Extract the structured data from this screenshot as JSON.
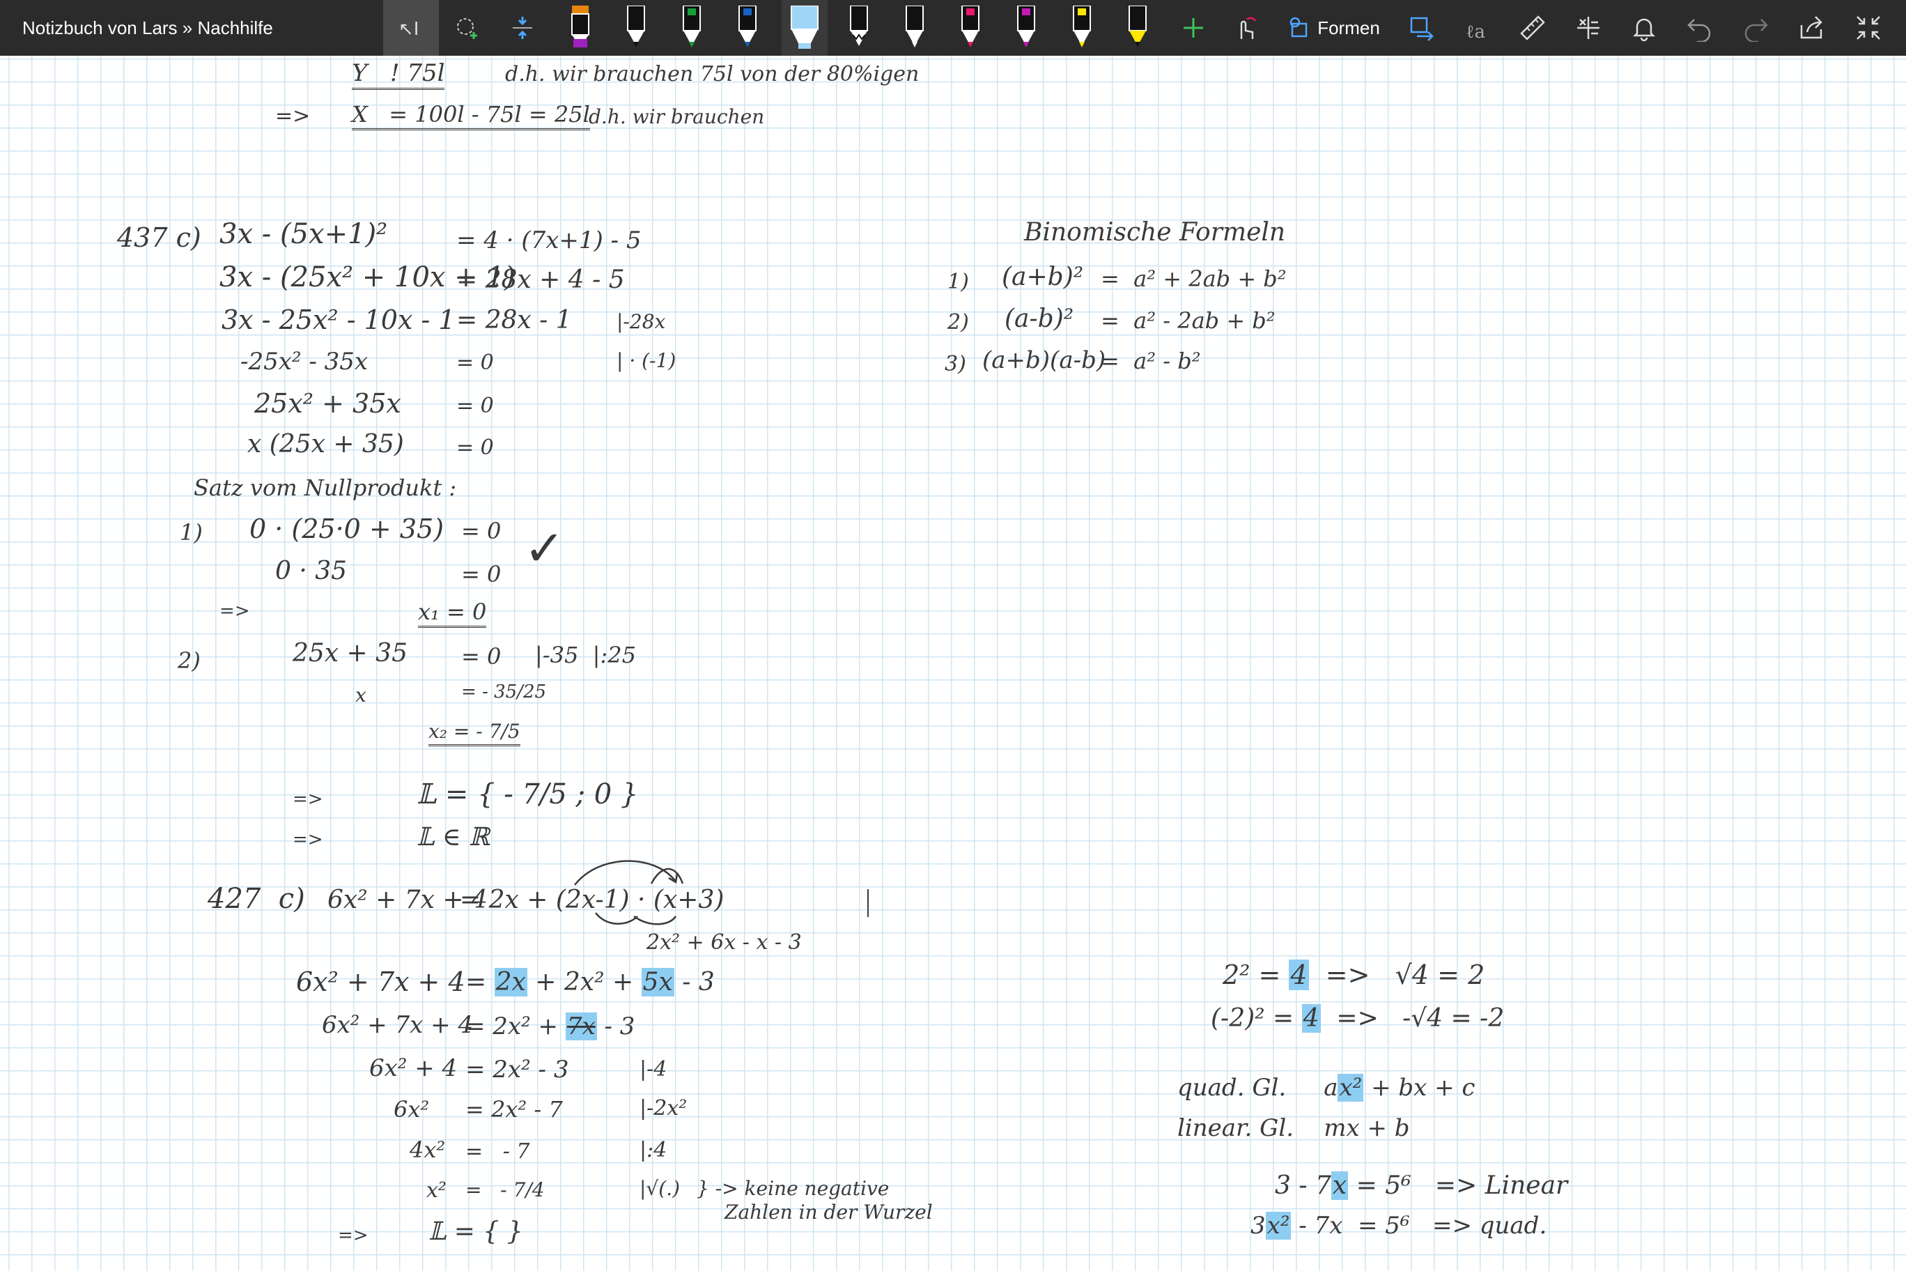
{
  "window": {
    "title": "Notizbuch von Lars » Nachhilfe"
  },
  "toolbar": {
    "formen_label": "Formen",
    "pen_colors": [
      "#e8860c",
      "#ffffff",
      "#1a9e3a",
      "#1565c0",
      "#9fd6f7",
      "#ffffff",
      "#ffffff",
      "#e8196b",
      "#c31ab8",
      "#ffe600",
      "#ffe600"
    ],
    "accent": "#1e90ff"
  },
  "notes": {
    "top1": "Y   ! 75l",
    "top1b": "d.h. wir brauchen 75l von der 80%igen",
    "top2_arrow": "=>",
    "top2": "X   = 100l - 75l = 25l",
    "top2b": "d.h. wir brauchen",
    "p437": "437 c)",
    "e1l": "3x - (5x+1)²",
    "e1r": "= 4 · (7x+1) - 5",
    "e2l": "3x - (25x² + 10x + 1)",
    "e2r": "= 28x + 4 - 5",
    "e3l": "3x - 25x² - 10x - 1",
    "e3r": "= 28x - 1",
    "e3op": "|-28x",
    "e4l": "-25x² - 35x",
    "e4r": "= 0",
    "e4op": "| · (-1)",
    "e5l": "25x² + 35x",
    "e5r": "= 0",
    "e6l": "x (25x + 35)",
    "e6r": "= 0",
    "satz": "Satz vom Nullprodukt :",
    "c1": "1)",
    "c1l": "0 · (25·0 + 35)",
    "c1r": "= 0",
    "c1bl": "0 · 35",
    "c1br": "= 0",
    "check": "✓",
    "arrow_x1": "=>",
    "x1": "x₁ = 0",
    "c2": "2)",
    "c2l": "25x + 35",
    "c2r": "= 0",
    "c2op": "|-35  |:25",
    "c2bl": "x",
    "c2br": "= - 35/25",
    "x2": "x₂ = - 7/5",
    "arrow_L": "=>",
    "L1": "𝕃 = { - 7/5 ; 0 }",
    "arrow_LR": "=>",
    "LR": "𝕃 ∈ ℝ",
    "binom_title": "Binomische Formeln",
    "b1n": "1)",
    "b1l": "(a+b)²",
    "b1r": "=  a² + 2ab + b²",
    "b2n": "2)",
    "b2l": "(a-b)²",
    "b2r": "=  a² - 2ab + b²",
    "b3n": "3)",
    "b3l": "(a+b)(a-b)",
    "b3r": "=  a² - b²",
    "p427": "427  c)",
    "q1l": "6x² + 7x + 4",
    "q1r": "= 2x + (2x-1) · (x+3)",
    "q1under": "2x² + 6x - x - 3",
    "q2l": "6x² + 7x + 4",
    "q2r_a": "= ",
    "q2r_hl1": "2x",
    "q2r_b": " + 2x² + ",
    "q2r_hl2": "5x",
    "q2r_c": " - 3",
    "q3l": "6x² + 7x + 4",
    "q3r_a": "= 2x² + ",
    "q3r_hl": "7x",
    "q3r_b": " - 3",
    "q4l": "6x² + 4",
    "q4r": "= 2x² - 3",
    "q4op": "|-4",
    "q5l": "6x²",
    "q5r": "= 2x² - 7",
    "q5op": "|-2x²",
    "q6l": "4x²",
    "q6r": "=   - 7",
    "q6op": "|:4",
    "q7l": "x²",
    "q7r": "=   - 7/4",
    "q7op": "|√(.)",
    "q7note1": "} -> keine negative",
    "q7note2": "Zahlen in der Wurzel",
    "arrow_L2": "=>",
    "L2": "𝕃 = { }",
    "r1a": "2² = ",
    "r1hl": "4",
    "r1b": "  =>   √4 = 2",
    "r2a": "(-2)² = ",
    "r2hl": "4",
    "r2b": "  =>   -√4 = -2",
    "quad_a": "quad. Gl.     a",
    "quad_hl": "x²",
    "quad_b": " + bx + c",
    "lin": "linear. Gl.    mx + b",
    "l1a": "3 - 7",
    "l1hl": "x",
    "l1b": " = 5⁶   => Linear",
    "l2a": "3",
    "l2hl": "x²",
    "l2b": " - 7x  = 5⁶   => quad."
  }
}
